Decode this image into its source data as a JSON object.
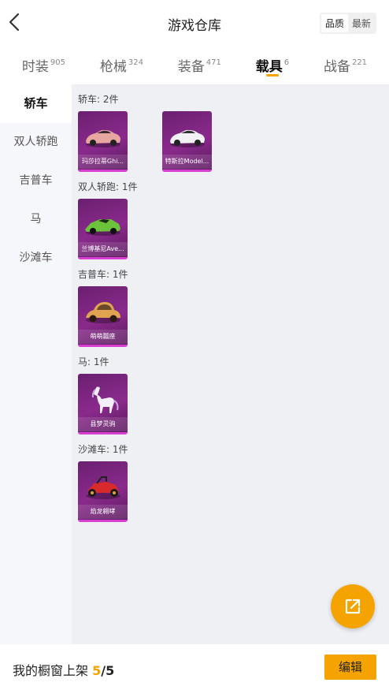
{
  "header": {
    "title": "游戏仓库",
    "sort_options": [
      "品质",
      "最新"
    ],
    "sort_active": 0
  },
  "tabs": [
    {
      "label": "时装",
      "count": "905"
    },
    {
      "label": "枪械",
      "count": "324"
    },
    {
      "label": "装备",
      "count": "471"
    },
    {
      "label": "载具",
      "count": "6",
      "active": true
    },
    {
      "label": "战备",
      "count": "221"
    }
  ],
  "sidebar": {
    "items": [
      "轿车",
      "双人轿跑",
      "吉普车",
      "马",
      "沙滩车"
    ],
    "active": 0
  },
  "sections": [
    {
      "label": "轿车: 2件",
      "items": [
        "玛莎拉蒂Ghi...",
        "特斯拉Model..."
      ]
    },
    {
      "label": "双人轿跑: 1件",
      "items": [
        "兰博基尼Ave..."
      ]
    },
    {
      "label": "吉普车: 1件",
      "items": [
        "萌萌瓢座"
      ]
    },
    {
      "label": "马: 1件",
      "items": [
        "县梦灵驹"
      ]
    },
    {
      "label": "沙滩车: 1件",
      "items": [
        "焰龙翱哮"
      ]
    }
  ],
  "footer": {
    "label": "我的橱窗上架",
    "current": "5",
    "separator": "/",
    "total": "5",
    "edit_label": "编辑"
  },
  "icons": {
    "back": "chevron-left-icon",
    "share": "external-link-icon"
  },
  "colors": {
    "accent": "#f5a300",
    "card_purple": "#8a2a8c",
    "card_border": "#d63fd0"
  }
}
